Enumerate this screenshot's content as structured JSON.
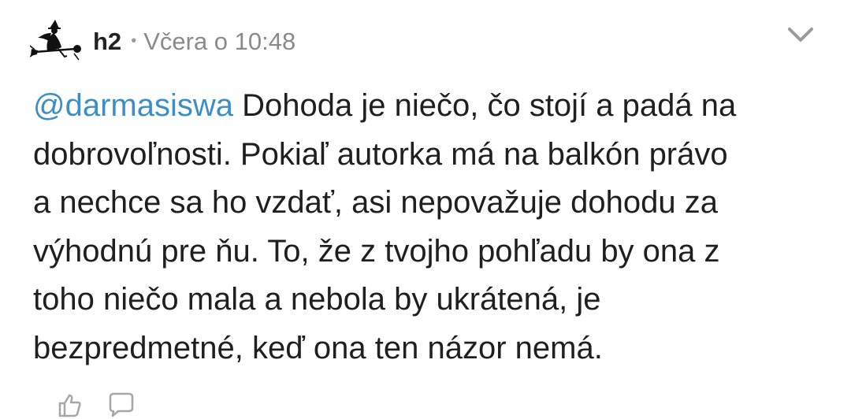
{
  "post": {
    "author": "h2",
    "separator": "•",
    "timestamp": "Včera o 10:48",
    "mention": "@darmasiswa",
    "text_lines": [
      " Dohoda je niečo, čo stojí a padá na",
      "dobrovoľnosti. Pokiaľ autorka má na balkón právo",
      "a nechce sa ho vzdať, asi nepovažuje dohodu za",
      "výhodnú pre ňu. To, že z tvojho pohľadu by ona z",
      "toho niečo mala a nebola by ukrátená, je",
      "bezpredmetné, keď ona ten názor nemá."
    ]
  },
  "icons": {
    "avatar": "witch-on-broom-avatar",
    "menu": "chevron-down-icon",
    "footer": [
      "like-icon",
      "comment-icon"
    ]
  },
  "colors": {
    "mention": "#3b8fc4",
    "text": "#1f1f1f",
    "meta": "#8a8a8a",
    "icon_gray": "#a6a6a6"
  }
}
